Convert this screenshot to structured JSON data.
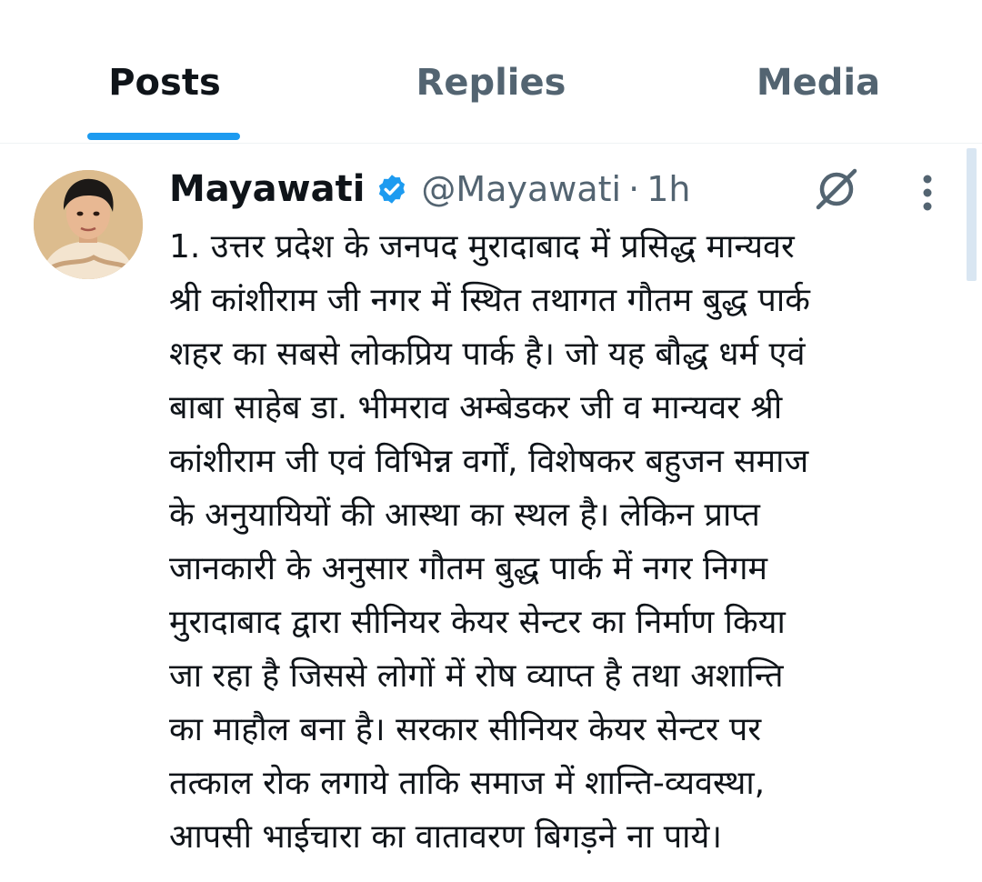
{
  "tabs": [
    {
      "label": "Posts",
      "active": true
    },
    {
      "label": "Replies",
      "active": false
    },
    {
      "label": "Media",
      "active": false
    }
  ],
  "accent_color": "#1d9bf0",
  "tweet": {
    "author_name": "Mayawati",
    "verified": true,
    "handle": "@Mayawati",
    "separator": "·",
    "time": "1h",
    "icons": [
      "grok-icon",
      "more-icon"
    ],
    "body": "1. उत्तर प्रदेश के जनपद मुरादाबाद में प्रसिद्ध मान्यवर\nश्री कांशीराम जी नगर में स्थित तथागत गौतम बुद्ध पार्क\nशहर का सबसे लोकप्रिय पार्क है। जो यह बौद्ध धर्म एवं\nबाबा साहेब डा. भीमराव अम्बेडकर जी व मान्यवर श्री\nकांशीराम जी एवं विभिन्न वर्गों, विशेषकर बहुजन समाज\nके अनुयायियों की आस्था का स्थल है। लेकिन प्राप्त\nजानकारी के अनुसार गौतम बुद्ध पार्क में नगर निगम\nमुरादाबाद द्वारा सीनियर केयर सेन्टर का निर्माण किया\nजा रहा है जिससे लोगों में रोष व्याप्त है तथा अशान्ति\nका माहौल बना है। सरकार सीनियर केयर सेन्टर पर\nतत्काल रोक लगाये ताकि समाज में शान्ति-व्यवस्था,\nआपसी भाईचारा का वातावरण बिगड़ने ना पाये।"
  }
}
